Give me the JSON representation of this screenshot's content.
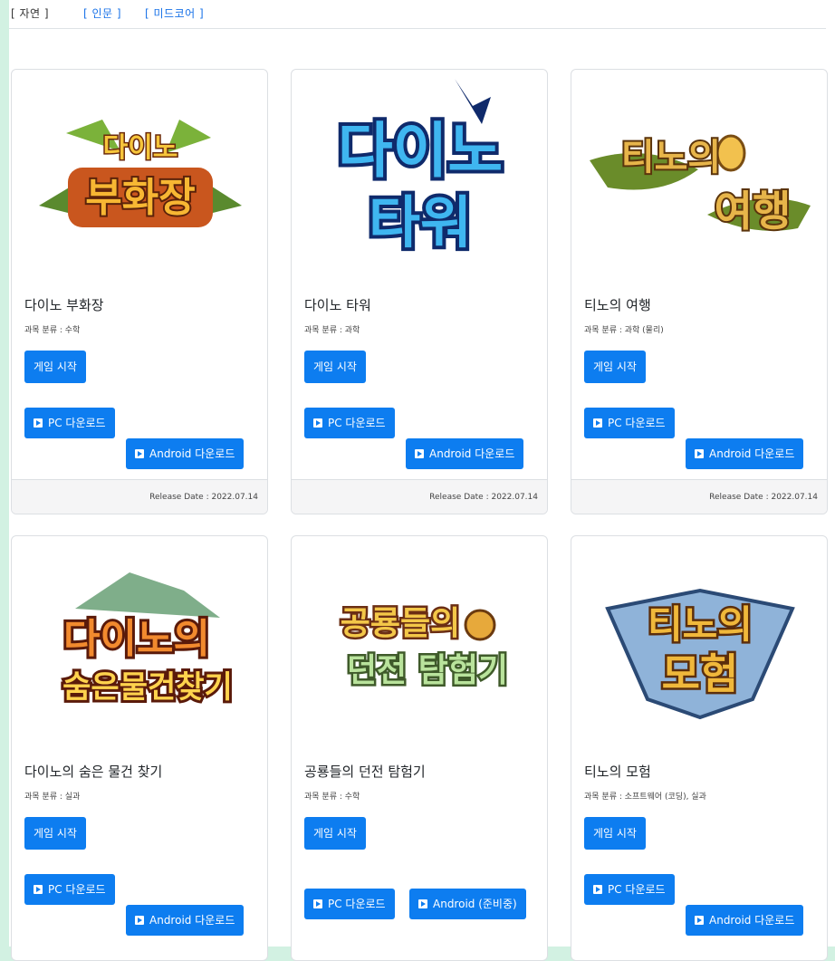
{
  "tabs": [
    {
      "label": "[ 자연 ]",
      "active": true
    },
    {
      "label": "[ 인문 ]",
      "active": false
    },
    {
      "label": "[ 미드코어 ]",
      "active": false
    }
  ],
  "colors": {
    "accent": "#0d7df0",
    "page_bg": "#d2f1e2"
  },
  "cards": [
    {
      "logo_text": [
        "다이노",
        "부화장"
      ],
      "title": "다이노 부화장",
      "category": "과목 분류 : 수학",
      "start_label": "게임 시작",
      "pc_label": "PC 다운로드",
      "android_label": "Android 다운로드",
      "release": "Release Date : 2022.07.14"
    },
    {
      "logo_text": [
        "다이노",
        "타워"
      ],
      "title": "다이노 타워",
      "category": "과목 분류 : 과학",
      "start_label": "게임 시작",
      "pc_label": "PC 다운로드",
      "android_label": "Android 다운로드",
      "release": "Release Date : 2022.07.14"
    },
    {
      "logo_text": [
        "티노의",
        "여행"
      ],
      "title": "티노의 여행",
      "category": "과목 분류 : 과학 (물리)",
      "start_label": "게임 시작",
      "pc_label": "PC 다운로드",
      "android_label": "Android 다운로드",
      "release": "Release Date : 2022.07.14"
    },
    {
      "logo_text": [
        "다이노의",
        "숨은물건찾기"
      ],
      "title": "다이노의 숨은 물건 찾기",
      "category": "과목 분류 : 실과",
      "start_label": "게임 시작",
      "pc_label": "PC 다운로드",
      "android_label": "Android 다운로드"
    },
    {
      "logo_text": [
        "공룡들의",
        "던전 탐험기"
      ],
      "title": "공룡들의 던전 탐험기",
      "category": "과목 분류 : 수학",
      "start_label": "게임 시작",
      "pc_label": "PC 다운로드",
      "android_label": "Android (준비중)"
    },
    {
      "logo_text": [
        "티노의",
        "모험"
      ],
      "title": "티노의 모험",
      "category": "과목 분류 : 소프트웨어 (코딩), 실과",
      "start_label": "게임 시작",
      "pc_label": "PC 다운로드",
      "android_label": "Android 다운로드"
    }
  ]
}
